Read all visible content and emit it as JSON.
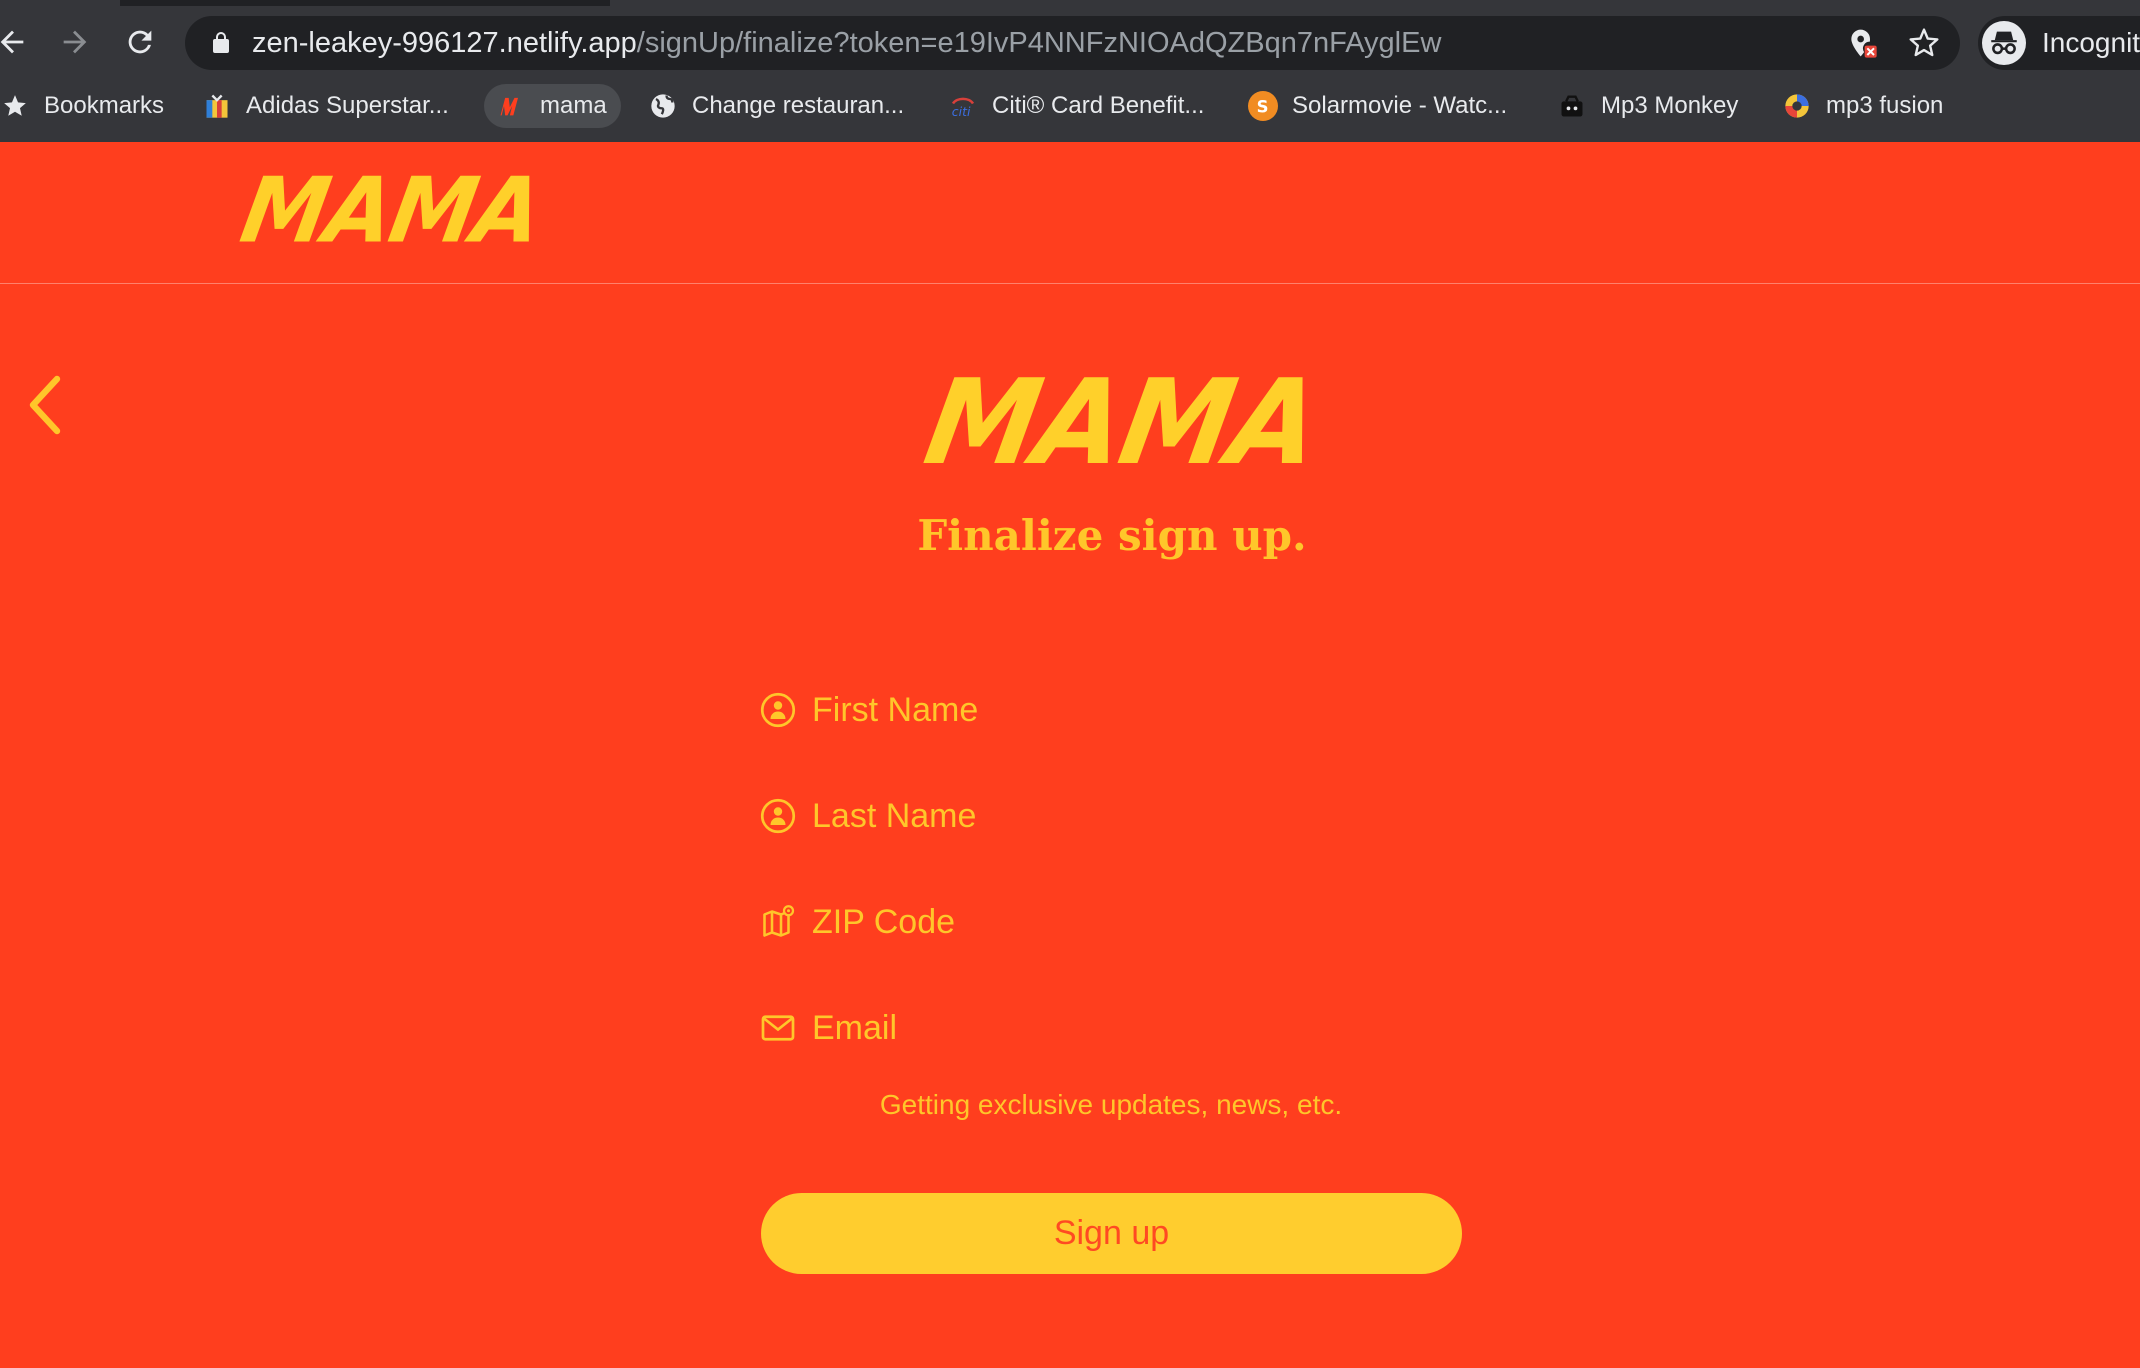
{
  "browser": {
    "url_host": "zen-leakey-996127.netlify.app",
    "url_path": "/signUp/finalize?token=e19IvP4NNFzNIOAdQZBqn7nFAyglEw",
    "profile_label": "Incognit",
    "bookmarks": [
      {
        "label": "Bookmarks",
        "icon": "star-icon"
      },
      {
        "label": "Adidas Superstar...",
        "icon": "gift-icon"
      },
      {
        "label": "mama",
        "icon": "mama-favicon"
      },
      {
        "label": "Change restauran...",
        "icon": "globe-icon"
      },
      {
        "label": "Citi® Card Benefit...",
        "icon": "citi-favicon"
      },
      {
        "label": "Solarmovie - Watc...",
        "icon": "solarmovie-favicon"
      },
      {
        "label": "Mp3 Monkey",
        "icon": "monkey-favicon"
      },
      {
        "label": "mp3 fusion",
        "icon": "fusion-favicon"
      }
    ]
  },
  "brand": {
    "logo_text": "MAMA",
    "bg_color": "#ff3e1e",
    "accent_color": "#ffc62a"
  },
  "page": {
    "title": "Finalize sign up.",
    "fields": {
      "first_name": {
        "placeholder": "First Name",
        "value": ""
      },
      "last_name": {
        "placeholder": "Last Name",
        "value": ""
      },
      "zip": {
        "placeholder": "ZIP Code",
        "value": ""
      },
      "email": {
        "placeholder": "Email",
        "value": ""
      }
    },
    "hint": "Getting exclusive updates, news, etc.",
    "submit_label": "Sign up"
  }
}
